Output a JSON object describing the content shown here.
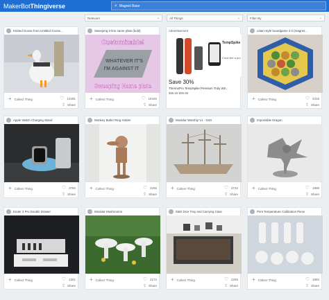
{
  "app": {
    "brand_left": "MakerBot",
    "brand_right": "Thingiverse"
  },
  "search": {
    "value": "Magnet Base"
  },
  "filters": [
    {
      "label": "Relevant"
    },
    {
      "label": "All Things"
    },
    {
      "label": "Filter By"
    }
  ],
  "cards": [
    {
      "title": "Knitted Goose from Untitled Goose...",
      "likes": "13491",
      "collect": "Collect Thing",
      "share": "Share"
    },
    {
      "title": "Sweeping 2-line name plate (bold)",
      "likes": "19445",
      "collect": "Collect Thing",
      "share": "Share"
    },
    {
      "title": "catan-style boardgame 2.0 (magnet...",
      "likes": "4316",
      "collect": "Collect Thing",
      "share": "Share"
    },
    {
      "title": "Apple Watch Charging Stand",
      "likes": "3750",
      "collect": "Collect Thing",
      "share": "Share"
    },
    {
      "title": "Monkey Butler Ring Holder",
      "likes": "2256",
      "collect": "Collect Thing",
      "share": "Share"
    },
    {
      "title": "Modular Warship V1 - DnD",
      "likes": "2732",
      "collect": "Collect Thing",
      "share": "Share"
    },
    {
      "title": "Impossible Dragon",
      "likes": "1999",
      "collect": "Collect Thing",
      "share": "Share"
    },
    {
      "title": "Ender 3 Pro Double Drawer",
      "likes": "1351",
      "collect": "Collect Thing",
      "share": "Share"
    },
    {
      "title": "Modular Mushrooms",
      "likes": "2172",
      "collect": "Collect Thing",
      "share": "Share"
    },
    {
      "title": "D&D Dice Tray and Carrying Case",
      "likes": "2256",
      "collect": "Collect Thing",
      "share": "Share"
    },
    {
      "title": "Print Temperature Calibration Piece",
      "likes": "1860",
      "collect": "Collect Thing",
      "share": "Share"
    }
  ],
  "ad": {
    "label": "Advertisement",
    "save": "Save 30%",
    "line1": "ThermoPro TempSpike Premium Truly Wir...",
    "price": "$69.69 $99.99",
    "brand_text": "TempSpike",
    "tagline": "Cook like a pro"
  },
  "thumb_texts": {
    "customizable": "Customizable!",
    "nameplate_line1": "WHATEVER IT'S",
    "nameplate_line2": "I'M AGAINST IT",
    "nameplate_bottom": "Sweeping Name plate"
  },
  "colors": {
    "topbar": "#1f6ed4",
    "page": "#eceff1"
  }
}
